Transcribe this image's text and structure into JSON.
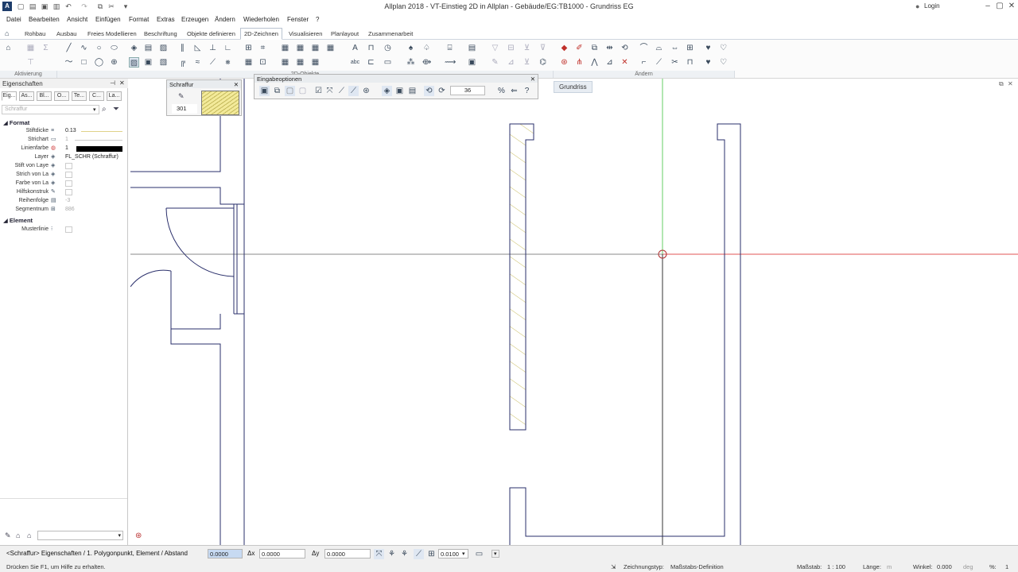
{
  "window": {
    "title": "Allplan 2018 - VT-Einstieg 2D in Allplan - Gebäude/EG:TB1000 - Grundriss EG",
    "login": "Login"
  },
  "menu": [
    "Datei",
    "Bearbeiten",
    "Ansicht",
    "Einfügen",
    "Format",
    "Extras",
    "Erzeugen",
    "Ändern",
    "Wiederholen",
    "Fenster",
    "?"
  ],
  "tabs": [
    "Rohbau",
    "Ausbau",
    "Freies Modellieren",
    "Beschriftung",
    "Objekte definieren",
    "2D-Zeichnen",
    "Visualisieren",
    "Planlayout",
    "Zusammenarbeit"
  ],
  "active_tab": "2D-Zeichnen",
  "ribbon_groups": {
    "aktivierung": "Aktivierung",
    "objekte2d": "2D-Objekte",
    "aendern": "Ändern"
  },
  "properties": {
    "header": "Eigenschaften",
    "tabs": [
      "Eig...",
      "As...",
      "Bl...",
      "O...",
      "Te...",
      "C...",
      "La..."
    ],
    "search_placeholder": "Schraffur",
    "section_format": "Format",
    "section_element": "Element",
    "rows": {
      "stiftdicke": {
        "label": "Stiftdicke",
        "value": "0.13"
      },
      "strichart": {
        "label": "Strichart",
        "value": "1"
      },
      "linienfarbe": {
        "label": "Linienfarbe",
        "value": "1"
      },
      "layer": {
        "label": "Layer",
        "value": "FL_SCHR (Schraffur)"
      },
      "stift_layer": {
        "label": "Stift von Laye"
      },
      "strich_layer": {
        "label": "Strich von La"
      },
      "farbe_layer": {
        "label": "Farbe von La"
      },
      "hilfskonstruktion": {
        "label": "Hilfskonstruk"
      },
      "reihenfolge": {
        "label": "Reihenfolge",
        "value": "-3"
      },
      "segmentnummer": {
        "label": "Segmentnum",
        "value": "886"
      },
      "musterlinie": {
        "label": "Musterlinie"
      }
    }
  },
  "schraffur_palette": {
    "title": "Schraffur",
    "number": "301"
  },
  "eingabe_palette": {
    "title": "Eingabeoptionen",
    "angle": "36"
  },
  "view_label": "Grundriss",
  "command_line": {
    "prompt": "<Schraffur> Eigenschaften / 1. Polygonpunkt, Element / Abstand",
    "value": "0.0000",
    "dx_label": "Δx",
    "dx": "0.0000",
    "dy_label": "Δy",
    "dy": "0.0000",
    "tolerance": "0.0100"
  },
  "status_bar": {
    "help": "Drücken Sie F1, um Hilfe zu erhalten.",
    "drawing_type_label": "Zeichnungstyp:",
    "drawing_type": "Maßstabs-Definition",
    "scale_label": "Maßstab:",
    "scale": "1 : 100",
    "length_label": "Länge:",
    "length_unit": "m",
    "angle_label": "Winkel:",
    "angle": "0.000",
    "angle_unit": "deg",
    "percent_label": "%:",
    "percent": "1"
  }
}
